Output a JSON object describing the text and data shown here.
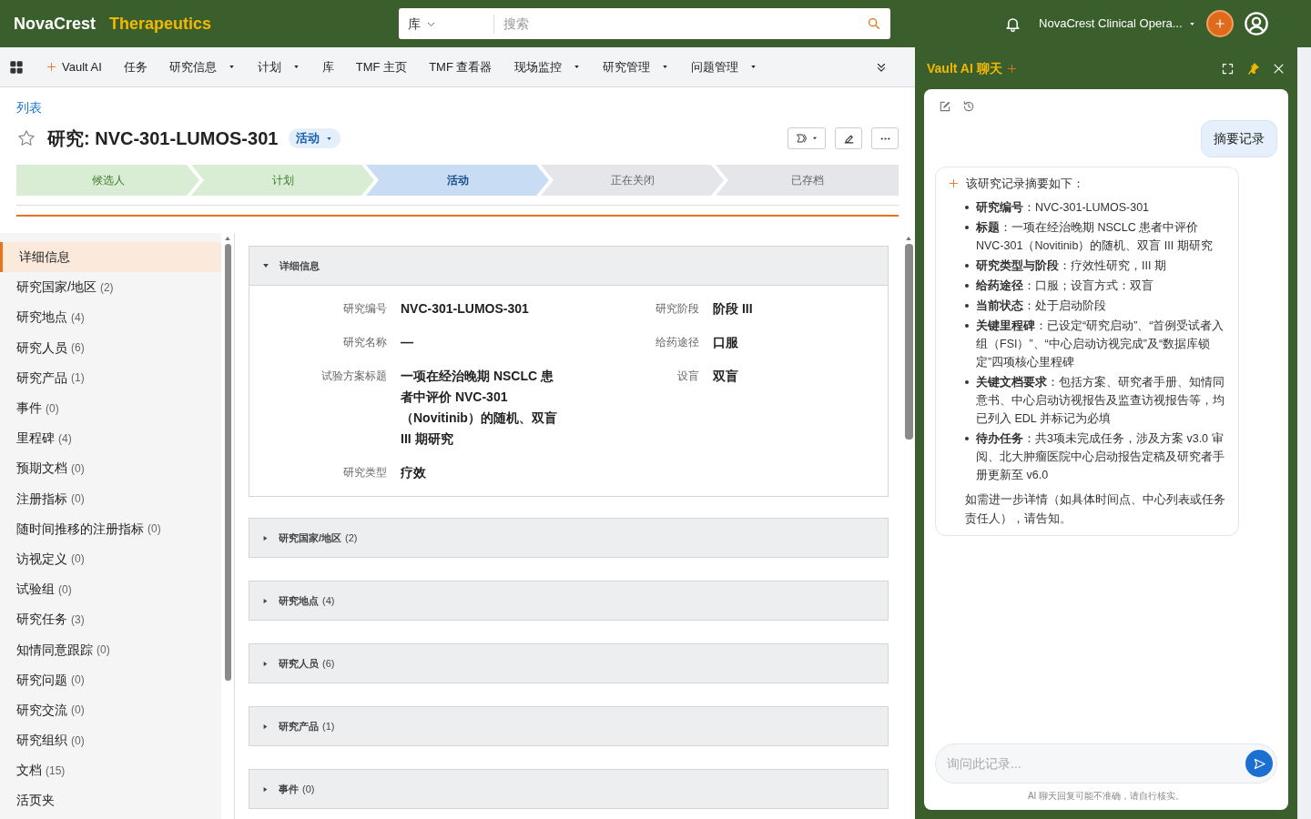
{
  "top_bar": {
    "brand": "NovaCrest",
    "brand_suffix": "Therapeutics",
    "search_scope": "库",
    "search_placeholder": "搜索",
    "user": "NovaCrest Clinical Opera..."
  },
  "nav": {
    "items": [
      {
        "label": "Vault AI",
        "kind": "ai",
        "caret": false
      },
      {
        "label": "任务",
        "kind": "plain",
        "caret": false
      },
      {
        "label": "研究信息",
        "kind": "plain",
        "caret": true
      },
      {
        "label": "计划",
        "kind": "plain",
        "caret": true
      },
      {
        "label": "库",
        "kind": "plain",
        "caret": false
      },
      {
        "label": "TMF 主页",
        "kind": "plain",
        "caret": false
      },
      {
        "label": "TMF 查看器",
        "kind": "plain",
        "caret": false
      },
      {
        "label": "现场监控",
        "kind": "plain",
        "caret": true
      },
      {
        "label": "研究管理",
        "kind": "plain",
        "caret": true
      },
      {
        "label": "问题管理",
        "kind": "plain",
        "caret": true
      }
    ]
  },
  "record": {
    "breadcrumb": "列表",
    "title": "研究: NVC-301-LUMOS-301",
    "status": "活动",
    "stages": [
      {
        "label": "候选人",
        "completed": true,
        "selected": false
      },
      {
        "label": "计划",
        "completed": true,
        "selected": false
      },
      {
        "label": "活动",
        "completed": false,
        "selected": true
      },
      {
        "label": "正在关闭",
        "completed": false,
        "selected": false
      },
      {
        "label": "已存档",
        "completed": false,
        "selected": false
      }
    ]
  },
  "sidebar": {
    "items": [
      {
        "label": "详细信息",
        "selected": true
      },
      {
        "label": "研究国家/地区",
        "count": "(2)",
        "selected": false
      },
      {
        "label": "研究地点",
        "count": "(4)",
        "selected": false
      },
      {
        "label": "研究人员",
        "count": "(6)",
        "selected": false
      },
      {
        "label": "研究产品",
        "count": "(1)",
        "selected": false
      },
      {
        "label": "事件",
        "count": "(0)",
        "selected": false
      },
      {
        "label": "里程碑",
        "count": "(4)",
        "selected": false
      },
      {
        "label": "预期文档",
        "count": "(0)",
        "selected": false
      },
      {
        "label": "注册指标",
        "count": "(0)",
        "selected": false
      },
      {
        "label": "随时间推移的注册指标",
        "count": "(0)",
        "selected": false
      },
      {
        "label": "访视定义",
        "count": "(0)",
        "selected": false
      },
      {
        "label": "试验组",
        "count": "(0)",
        "selected": false
      },
      {
        "label": "研究任务",
        "count": "(3)",
        "selected": false
      },
      {
        "label": "知情同意跟踪",
        "count": "(0)",
        "selected": false
      },
      {
        "label": "研究问题",
        "count": "(0)",
        "selected": false
      },
      {
        "label": "研究交流",
        "count": "(0)",
        "selected": false
      },
      {
        "label": "研究组织",
        "count": "(0)",
        "selected": false
      },
      {
        "label": "文档",
        "count": "(15)",
        "selected": false
      },
      {
        "label": "活页夹",
        "selected": false
      }
    ]
  },
  "sections": [
    {
      "title": "详细信息",
      "expanded": true,
      "left_fields": [
        {
          "label": "研究编号",
          "value": "NVC-301-LUMOS-301"
        },
        {
          "label": "研究名称",
          "value": "—"
        },
        {
          "label": "试验方案标题",
          "value": "一项在经治晚期 NSCLC 患者中评价 NVC-301（Novitinib）的随机、双盲 III 期研究"
        },
        {
          "label": "研究类型",
          "value": "疗效"
        }
      ],
      "right_fields": [
        {
          "label": "研究阶段",
          "value": "阶段 III"
        },
        {
          "label": "给药途径",
          "value": "口服"
        },
        {
          "label": "设盲",
          "value": "双盲"
        }
      ]
    },
    {
      "title": "研究国家/地区",
      "count": "(2)",
      "expanded": false
    },
    {
      "title": "研究地点",
      "count": "(4)",
      "expanded": false
    },
    {
      "title": "研究人员",
      "count": "(6)",
      "expanded": false
    },
    {
      "title": "研究产品",
      "count": "(1)",
      "expanded": false
    },
    {
      "title": "事件",
      "count": "(0)",
      "expanded": false
    }
  ],
  "chat": {
    "title": "Vault AI 聊天",
    "user_message": "摘要记录",
    "reply_intro": "该研究记录摘要如下：",
    "reply_points": [
      "**研究编号**：NVC-301-LUMOS-301",
      "**标题**：一项在经治晚期 NSCLC 患者中评价 NVC-301（Novitinib）的随机、双盲 III 期研究",
      "**研究类型与阶段**：疗效性研究，III 期",
      "**给药途径**：口服；设盲方式：双盲",
      "**当前状态**：处于启动阶段",
      "**关键里程碑**：已设定“研究启动”、“首例受试者入组（FSI）”、“中心启动访视完成”及“数据库锁定”四项核心里程碑",
      "**关键文档要求**：包括方案、研究者手册、知情同意书、中心启动访视报告及监查访视报告等，均已列入 EDL 并标记为必填",
      "**待办任务**：共3项未完成任务，涉及方案 v3.0 审阅、北大肿瘤医院中心启动报告定稿及研究者手册更新至 v6.0"
    ],
    "reply_outro": "如需进一步详情（如具体时间点、中心列表或任务责任人），请告知。",
    "input_placeholder": "询问此记录...",
    "disclaimer": "AI 聊天回复可能不准确，请自行核实。"
  }
}
